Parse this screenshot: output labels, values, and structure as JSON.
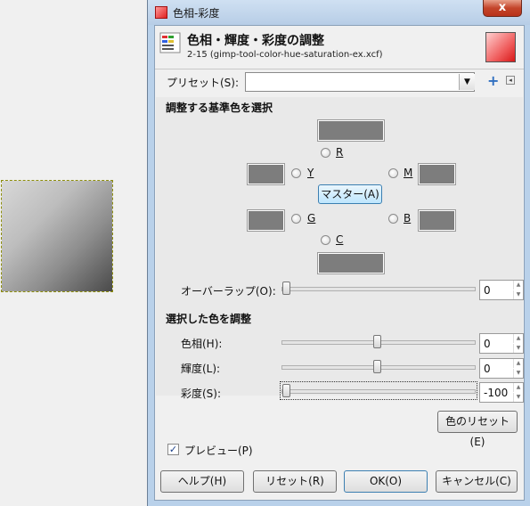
{
  "window": {
    "title": "色相-彩度",
    "close_glyph": "x"
  },
  "header": {
    "title": "色相・輝度・彩度の調整",
    "subtitle": "2-15 (gimp-tool-color-hue-saturation-ex.xcf)",
    "swatch_color": "#f04040"
  },
  "preset": {
    "label": "プリセット(S):",
    "value": "",
    "add_icon": "+",
    "menu_icon": "◂"
  },
  "primary_section": {
    "title": "調整する基準色を選択",
    "colors": [
      {
        "label": "R"
      },
      {
        "label": "Y"
      },
      {
        "label": "M"
      },
      {
        "label": "G"
      },
      {
        "label": "B"
      },
      {
        "label": "C"
      }
    ],
    "master_label": "マスター(A)"
  },
  "overlap": {
    "label": "オーバーラップ(O):",
    "value": "0"
  },
  "adjust_section": {
    "title": "選択した色を調整",
    "hue": {
      "label": "色相(H):",
      "value": "0"
    },
    "lightness": {
      "label": "輝度(L):",
      "value": "0"
    },
    "saturation": {
      "label": "彩度(S):",
      "value": "-100"
    },
    "reset_color_label": "色のリセット(E)"
  },
  "preview": {
    "label": "プレビュー(P)",
    "checked": "✓"
  },
  "buttons": {
    "help": "ヘルプ(H)",
    "reset": "リセット(R)",
    "ok": "OK(O)",
    "cancel": "キャンセル(C)"
  },
  "spin_arrows": {
    "up": "▲",
    "down": "▼"
  },
  "colors": {
    "accent": "#3c7fb1",
    "swatch_gray": "#7d7d7d"
  }
}
